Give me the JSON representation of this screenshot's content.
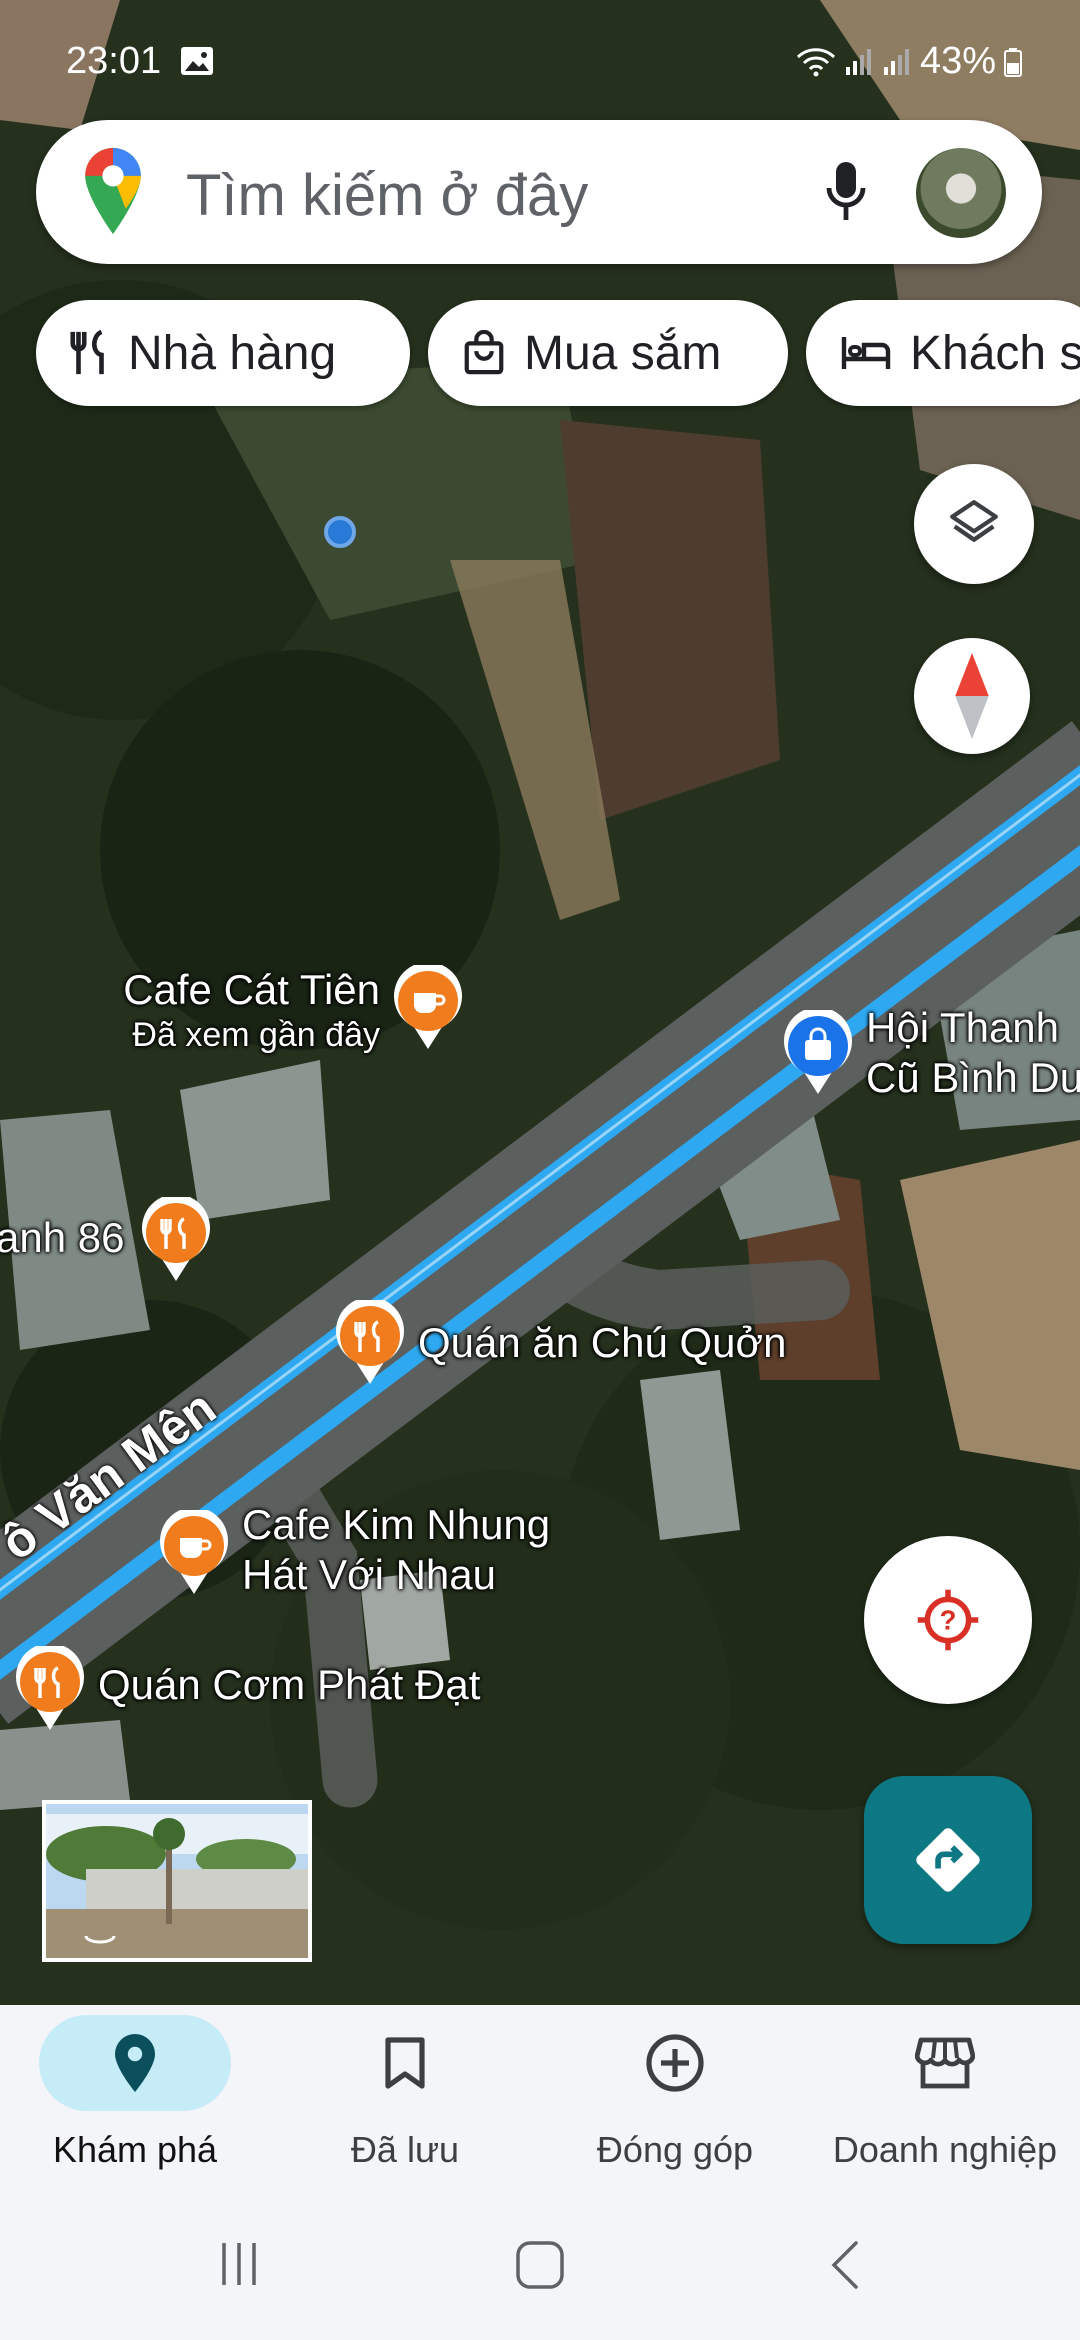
{
  "status_bar": {
    "time": "23:01",
    "battery": "43%",
    "icons": [
      "image-icon",
      "wifi-icon",
      "signal-icon",
      "signal-icon",
      "battery-icon"
    ]
  },
  "search": {
    "placeholder": "Tìm kiếm ở đây",
    "icons": [
      "google-maps-logo-icon",
      "microphone-icon",
      "avatar"
    ]
  },
  "chips": [
    {
      "label": "Nhà hàng",
      "icon": "restaurant-icon"
    },
    {
      "label": "Mua sắm",
      "icon": "shopping-bag-icon"
    },
    {
      "label": "Khách s",
      "icon": "hotel-bed-icon"
    }
  ],
  "map": {
    "road_label": "ô Văn Mên",
    "pois": [
      {
        "name": "Cafe Cát Tiên",
        "subtitle": "Đã xem gần đây",
        "icon": "cafe-icon",
        "color": "#f07c1e"
      },
      {
        "name": "Hội Thanh",
        "subtitle": "Cũ Bình Du",
        "icon": "shopping-bag-icon",
        "color": "#1a73e8"
      },
      {
        "name": "anh 86",
        "icon": "restaurant-icon",
        "color": "#f07c1e"
      },
      {
        "name": "Quán ăn Chú Quởn",
        "icon": "restaurant-icon",
        "color": "#f07c1e"
      },
      {
        "name": "Cafe Kim Nhung",
        "subtitle": "Hát Với Nhau",
        "icon": "cafe-icon",
        "color": "#f07c1e"
      },
      {
        "name": "Quán Cơm Phát Đạt",
        "icon": "restaurant-icon",
        "color": "#f07c1e"
      }
    ],
    "route_color": "#2ea8f0",
    "controls": [
      "layers-icon",
      "compass-icon",
      "my-location-icon",
      "directions-icon",
      "street-view-thumbnail"
    ]
  },
  "bottom_nav": [
    {
      "label": "Khám phá",
      "icon": "explore-pin-icon",
      "active": true
    },
    {
      "label": "Đã lưu",
      "icon": "bookmark-icon",
      "active": false
    },
    {
      "label": "Đóng góp",
      "icon": "add-circle-icon",
      "active": false
    },
    {
      "label": "Doanh nghiệp",
      "icon": "storefront-icon",
      "active": false
    }
  ],
  "system_nav": [
    "recent-apps-icon",
    "home-icon",
    "back-icon"
  ],
  "colors": {
    "accent": "#0e7784",
    "poi_orange": "#f07c1e",
    "poi_blue": "#1a73e8",
    "nav_active": "#c6ecf7"
  }
}
